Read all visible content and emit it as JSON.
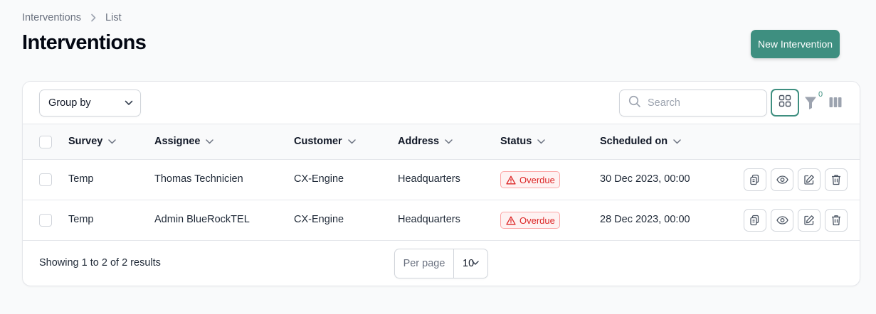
{
  "breadcrumb": {
    "parent": "Interventions",
    "current": "List"
  },
  "page_title": "Interventions",
  "new_button_label": "New Intervention",
  "toolbar": {
    "group_by_label": "Group by",
    "search_placeholder": "Search",
    "filter_count": "0"
  },
  "columns": [
    "Survey",
    "Assignee",
    "Customer",
    "Address",
    "Status",
    "Scheduled on"
  ],
  "rows": [
    {
      "survey": "Temp",
      "assignee": "Thomas Technicien",
      "customer": "CX-Engine",
      "address": "Headquarters",
      "status": "Overdue",
      "scheduled": "30 Dec 2023, 00:00"
    },
    {
      "survey": "Temp",
      "assignee": "Admin BlueRockTEL",
      "customer": "CX-Engine",
      "address": "Headquarters",
      "status": "Overdue",
      "scheduled": "28 Dec 2023, 00:00"
    }
  ],
  "footer": {
    "results_text": "Showing 1 to 2 of 2 results",
    "per_page_label": "Per page",
    "per_page_value": "10"
  },
  "colors": {
    "accent": "#3e8f80",
    "danger": "#dc2626"
  },
  "icons": [
    "chevron-right-icon",
    "chevron-down-icon",
    "search-icon",
    "grid-icon",
    "filter-icon",
    "columns-icon",
    "warning-icon",
    "replicate-icon",
    "view-icon",
    "edit-icon",
    "delete-icon"
  ]
}
